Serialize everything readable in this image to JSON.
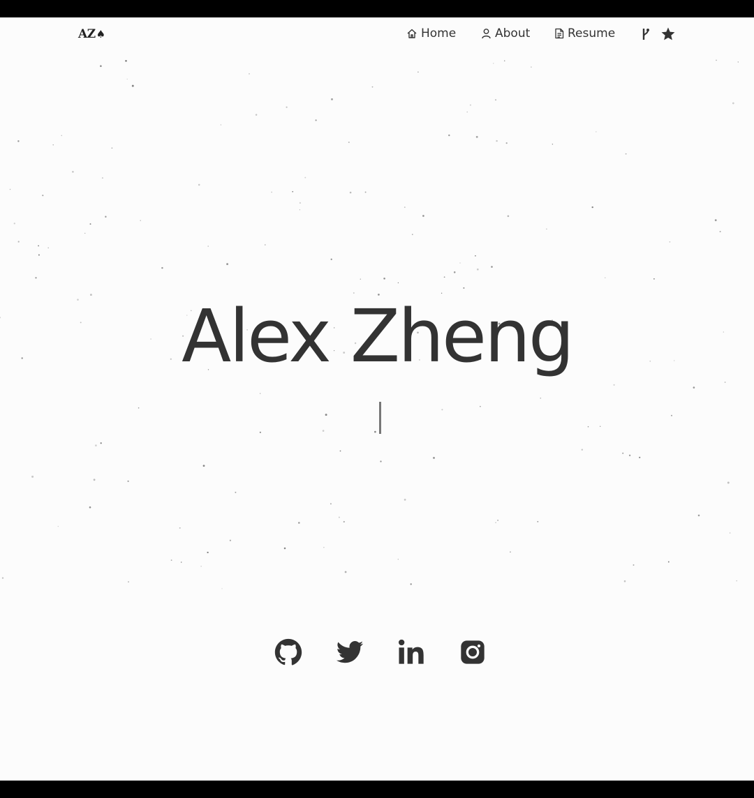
{
  "navbar": {
    "logo_text": "AZ",
    "links": [
      {
        "label": "Home",
        "icon": "home-icon"
      },
      {
        "label": "About",
        "icon": "user-icon"
      },
      {
        "label": "Resume",
        "icon": "document-icon"
      }
    ],
    "extra_icons": [
      "git-fork-icon",
      "star-icon"
    ]
  },
  "hero": {
    "name": "Alex Zheng",
    "typewriter_text": ""
  },
  "social": [
    {
      "name": "github",
      "icon": "github-icon"
    },
    {
      "name": "twitter",
      "icon": "twitter-icon"
    },
    {
      "name": "linkedin",
      "icon": "linkedin-icon"
    },
    {
      "name": "instagram",
      "icon": "instagram-icon"
    }
  ],
  "colors": {
    "background": "#fcfcfc",
    "text": "#333333",
    "frame": "#000000"
  }
}
